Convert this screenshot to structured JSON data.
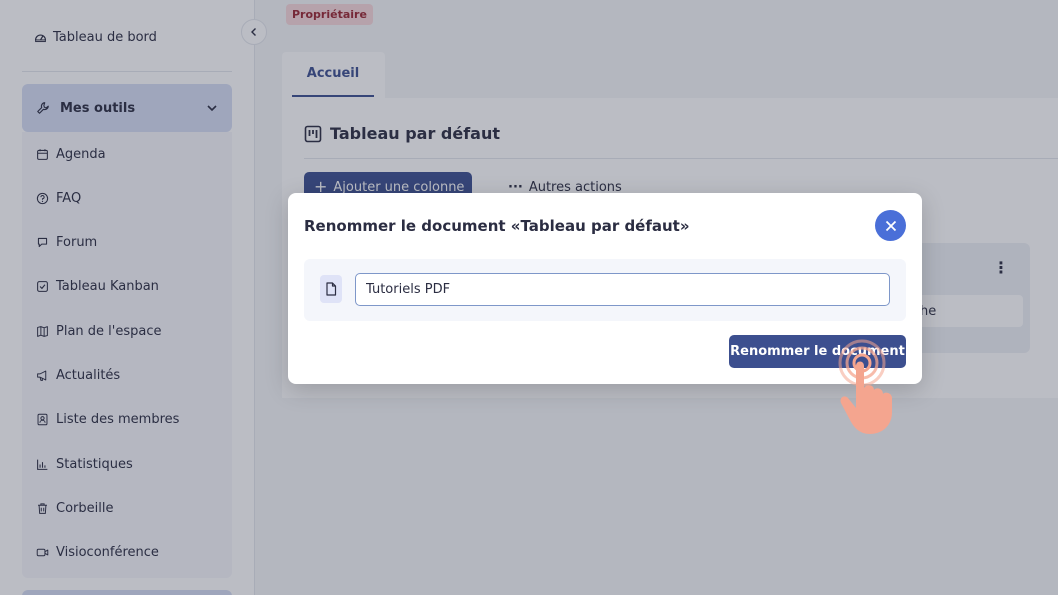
{
  "sidebar": {
    "dashboard_label": "Tableau de bord",
    "tools_label": "Mes outils",
    "items": [
      {
        "label": "Agenda",
        "icon": "calendar-icon"
      },
      {
        "label": "FAQ",
        "icon": "question-icon"
      },
      {
        "label": "Forum",
        "icon": "chat-icon"
      },
      {
        "label": "Tableau Kanban",
        "icon": "checkbox-icon"
      },
      {
        "label": "Plan de l'espace",
        "icon": "map-icon"
      },
      {
        "label": "Actualités",
        "icon": "megaphone-icon"
      },
      {
        "label": "Liste des membres",
        "icon": "contacts-icon"
      },
      {
        "label": "Statistiques",
        "icon": "bar-chart-icon"
      },
      {
        "label": "Corbeille",
        "icon": "trash-icon"
      },
      {
        "label": "Visioconférence",
        "icon": "video-icon"
      }
    ]
  },
  "header": {
    "role_badge": "Propriétaire",
    "tab_label": "Accueil"
  },
  "board": {
    "title": "Tableau par défaut",
    "add_column_label": "Ajouter une colonne",
    "more_actions_label": "Autres actions",
    "card_menu": "⋮",
    "card_item_text": "he"
  },
  "modal": {
    "title": "Renommer le document «Tableau par défaut»",
    "input_value": "Tutoriels PDF",
    "submit_label": "Renommer le document"
  },
  "colors": {
    "primary": "#3c4f8f",
    "close_button": "#4a6fd8",
    "badge_bg": "#f8d7da",
    "badge_text": "#9a2631",
    "hand": "#f4a58f"
  }
}
